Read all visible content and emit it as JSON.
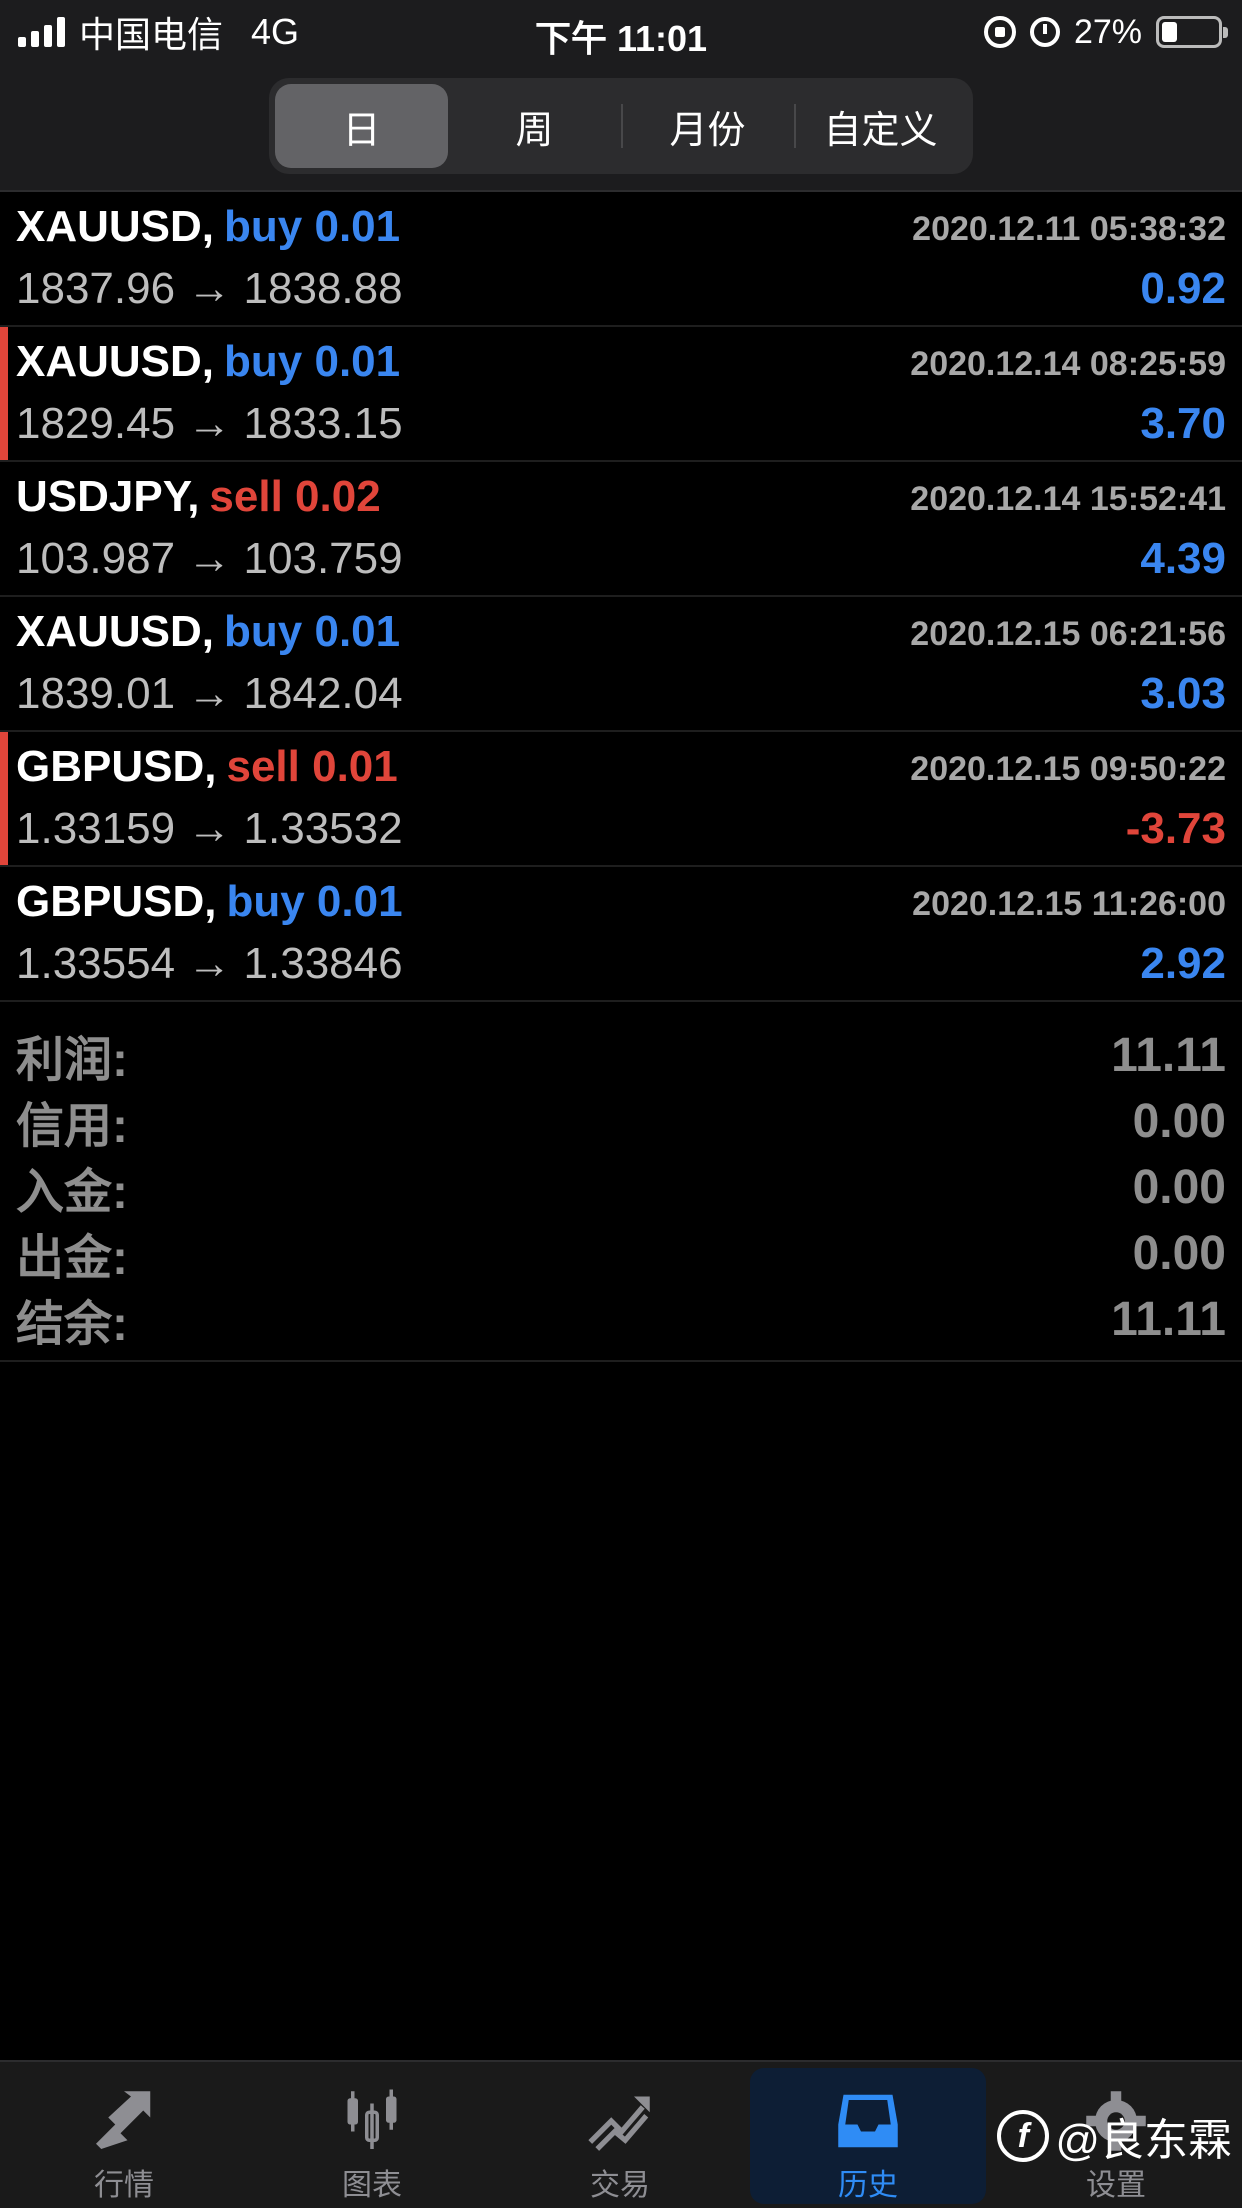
{
  "status_bar": {
    "carrier": "中国电信",
    "network": "4G",
    "time": "下午 11:01",
    "battery": "27%",
    "battery_level": 0.27
  },
  "segments": [
    {
      "label": "日",
      "active": true
    },
    {
      "label": "周",
      "active": false
    },
    {
      "label": "月份",
      "active": false
    },
    {
      "label": "自定义",
      "active": false
    }
  ],
  "trades": [
    {
      "symbol": "XAUUSD,",
      "side": "buy 0.01",
      "time": "2020.12.11 05:38:32",
      "open": "1837.96",
      "arrow": "→",
      "close": "1838.88",
      "profit": "0.92"
    },
    {
      "symbol": "XAUUSD,",
      "side": "buy 0.01",
      "time": "2020.12.14 08:25:59",
      "open": "1829.45",
      "arrow": "→",
      "close": "1833.15",
      "profit": "3.70"
    },
    {
      "symbol": "USDJPY,",
      "side": "sell 0.02",
      "time": "2020.12.14 15:52:41",
      "open": "103.987",
      "arrow": "→",
      "close": "103.759",
      "profit": "4.39"
    },
    {
      "symbol": "XAUUSD,",
      "side": "buy 0.01",
      "time": "2020.12.15 06:21:56",
      "open": "1839.01",
      "arrow": "→",
      "close": "1842.04",
      "profit": "3.03"
    },
    {
      "symbol": "GBPUSD,",
      "side": "sell 0.01",
      "time": "2020.12.15 09:50:22",
      "open": "1.33159",
      "arrow": "→",
      "close": "1.33532",
      "profit": "-3.73"
    },
    {
      "symbol": "GBPUSD,",
      "side": "buy 0.01",
      "time": "2020.12.15 11:26:00",
      "open": "1.33554",
      "arrow": "→",
      "close": "1.33846",
      "profit": "2.92"
    }
  ],
  "summary": [
    {
      "label": "利润:",
      "value": "11.11"
    },
    {
      "label": "信用:",
      "value": "0.00"
    },
    {
      "label": "入金:",
      "value": "0.00"
    },
    {
      "label": "出金:",
      "value": "0.00"
    },
    {
      "label": "结余:",
      "value": "11.11"
    }
  ],
  "tabs": [
    {
      "label": "行情",
      "icon": "quotes-icon"
    },
    {
      "label": "图表",
      "icon": "chart-icon"
    },
    {
      "label": "交易",
      "icon": "trade-icon"
    },
    {
      "label": "历史",
      "icon": "history-icon",
      "active": true
    },
    {
      "label": "设置",
      "icon": "gear-icon"
    }
  ],
  "watermark": {
    "logo": "f",
    "text": "@良东霖"
  },
  "colors": {
    "buy": "#3a86f0",
    "sell": "#e0453a",
    "active_tab": "#2f8cf5"
  }
}
